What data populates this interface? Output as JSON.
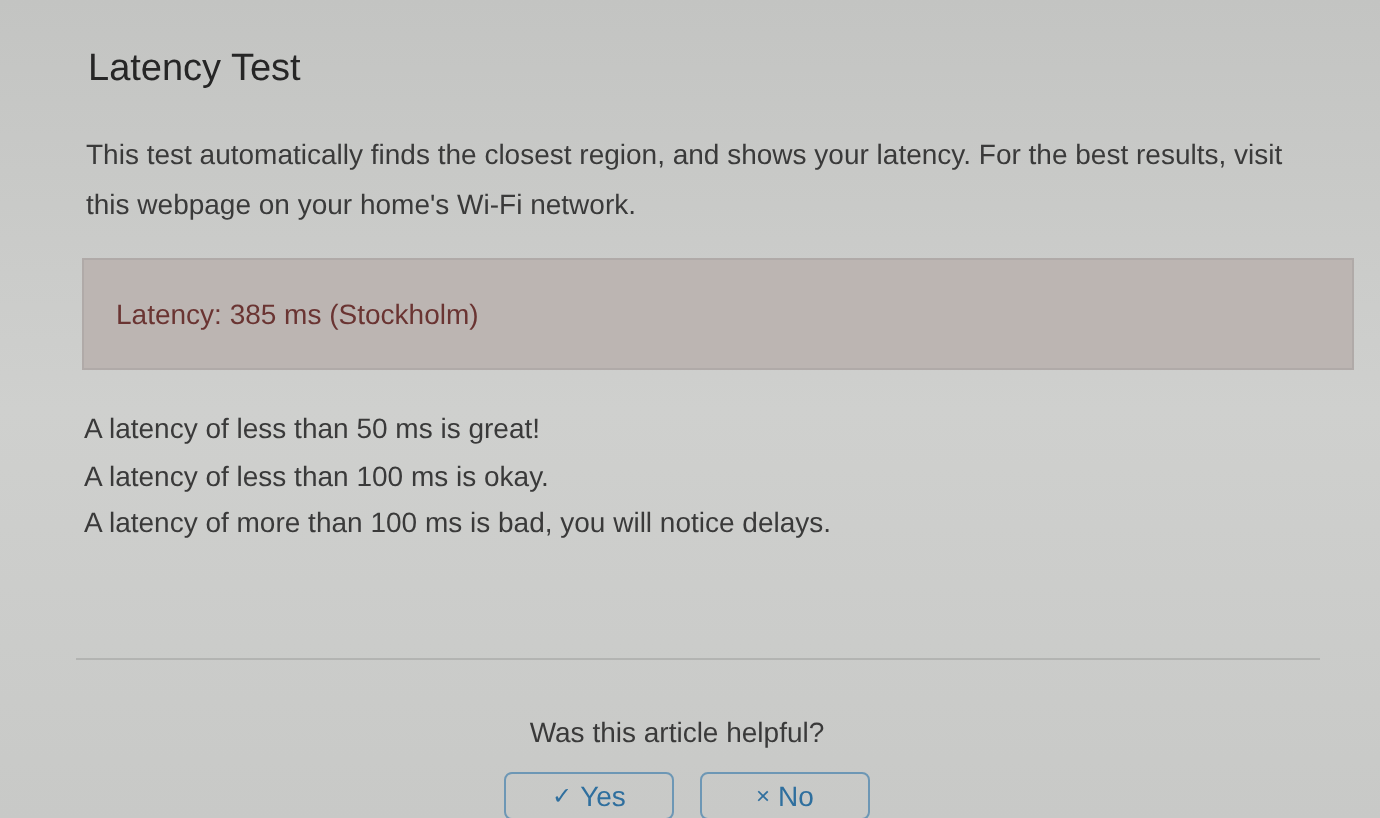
{
  "title": "Latency Test",
  "intro": "This test automatically finds the closest region, and shows your latency. For the best results, visit this webpage on your home's Wi-Fi network.",
  "result": "Latency: 385 ms (Stockholm)",
  "guidelines": [
    "A latency of less than 50 ms is great!",
    "A latency of less than 100 ms is okay.",
    "A latency of more than 100 ms is bad, you will notice delays."
  ],
  "feedback": {
    "question": "Was this article helpful?",
    "buttons": [
      {
        "icon": "✓",
        "label": "Yes"
      },
      {
        "icon": "×",
        "label": "No"
      }
    ]
  }
}
